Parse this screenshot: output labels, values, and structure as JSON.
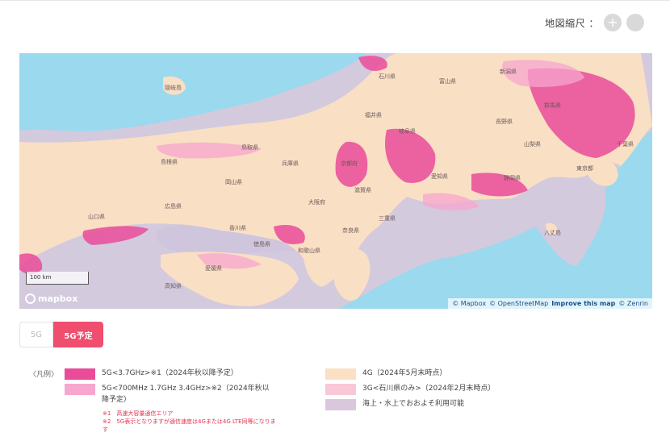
{
  "zoom": {
    "label": "地図縮尺 ：",
    "zoom_in": "+",
    "zoom_out": "−"
  },
  "map": {
    "regions": [
      "隠岐島",
      "石川県",
      "富山県",
      "新潟県",
      "福井県",
      "岐阜県",
      "長野県",
      "群馬県",
      "山梨県",
      "静岡県",
      "愛知県",
      "滋賀県",
      "京都府",
      "兵庫県",
      "鳥取県",
      "島根県",
      "岡山県",
      "広島県",
      "山口県",
      "大阪府",
      "奈良県",
      "三重県",
      "和歌山県",
      "香川県",
      "徳島県",
      "愛媛県",
      "高知県",
      "東京都",
      "千葉県",
      "八丈島"
    ],
    "scale_label": "100 km",
    "logo_text": "mapbox",
    "attribution": [
      "© Mapbox",
      "© OpenStreetMap",
      "Improve this map",
      "© Zenrin"
    ]
  },
  "tabs": [
    {
      "label": "5G",
      "active": false
    },
    {
      "label": "5G予定",
      "active": true
    }
  ],
  "legend": {
    "heading": "〈凡例〉",
    "items": [
      {
        "color": "#ea4c9a",
        "label": "5G<3.7GHz>※1（2024年秋以降予定）"
      },
      {
        "color": "#f7a6ce",
        "label": "5G<700MHz 1.7GHz 3.4GHz>※2（2024年秋以降予定）"
      },
      {
        "color": "#fbe0c5",
        "label": "4G（2024年5月末時点）"
      },
      {
        "color": "#f8c8d6",
        "label": "3G<石川県のみ>（2024年2月末時点）"
      },
      {
        "color": "#d9c8dc",
        "label": "海上・水上でおおよそ利用可能"
      }
    ],
    "notes": [
      "※1　高速大容量通信エリア",
      "※2　5G表示となりますが通信速度は4Gまたは4G LTE同等になります"
    ]
  },
  "colors": {
    "sea": "#9ad9ee",
    "land": "#f9dfc4",
    "offshore": "#d9c8dc",
    "coverage_5g_dense": "#ea4c9a",
    "coverage_5g_light": "#f7a6ce",
    "accent": "#f04e6e"
  }
}
